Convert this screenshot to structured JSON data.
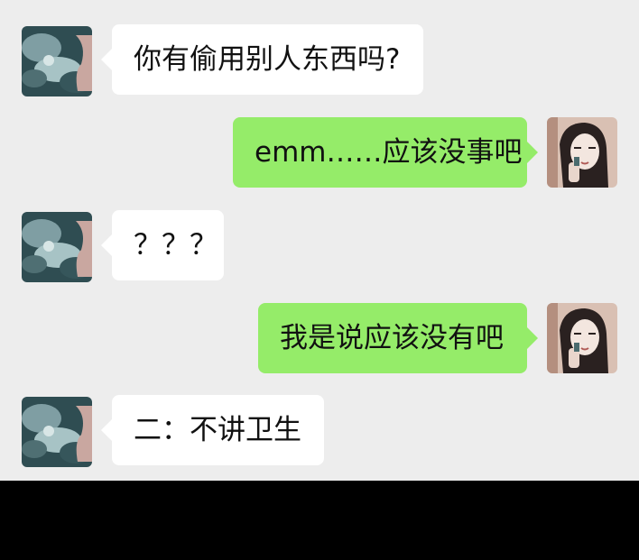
{
  "messages": [
    {
      "side": "left",
      "text": "你有偷用别人东西吗?",
      "avatar": "friend-avatar"
    },
    {
      "side": "right",
      "text": "emm……应该没事吧",
      "avatar": "self-avatar"
    },
    {
      "side": "left",
      "text": "？？？",
      "avatar": "friend-avatar"
    },
    {
      "side": "right",
      "text": "我是说应该没有吧",
      "avatar": "self-avatar"
    },
    {
      "side": "left",
      "text": "二：不讲卫生",
      "avatar": "friend-avatar"
    }
  ],
  "colors": {
    "chat_background": "#ededed",
    "incoming_bubble": "#ffffff",
    "outgoing_bubble": "#95ec69",
    "text": "#111111"
  }
}
